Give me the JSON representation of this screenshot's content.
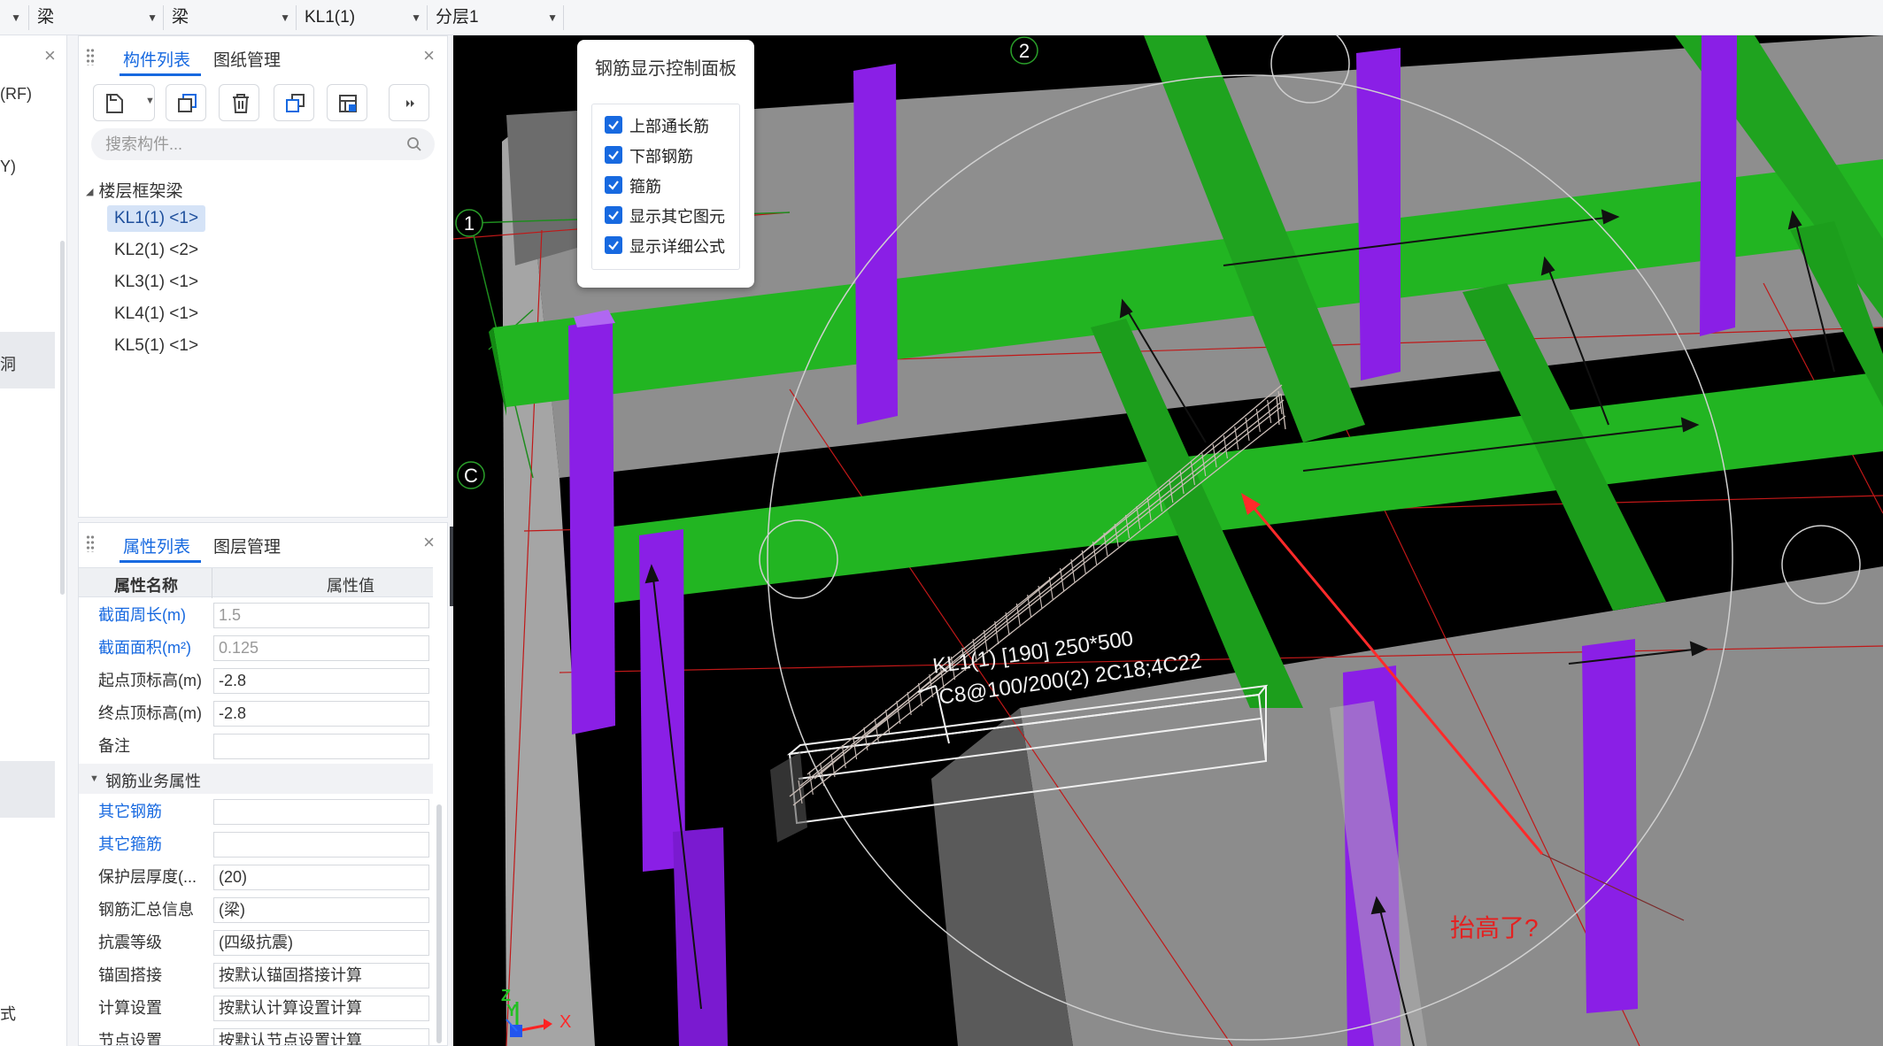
{
  "topbar": {
    "dropdowns": [
      {
        "value": ""
      },
      {
        "value": "梁"
      },
      {
        "value": "梁"
      },
      {
        "value": "KL1(1)"
      },
      {
        "value": "分层1"
      }
    ]
  },
  "farleft": {
    "items": [
      "(RF)",
      "Y)",
      "洞",
      "式"
    ]
  },
  "component_panel": {
    "tabs": [
      "构件列表",
      "图纸管理"
    ],
    "active_tab": 0,
    "search_placeholder": "搜索构件...",
    "tree_group": "楼层框架梁",
    "items": [
      "KL1(1) <1>",
      "KL2(1) <2>",
      "KL3(1) <1>",
      "KL4(1) <1>",
      "KL5(1) <1>"
    ],
    "selected_index": 0
  },
  "property_panel": {
    "tabs": [
      "属性列表",
      "图层管理"
    ],
    "active_tab": 0,
    "header_name": "属性名称",
    "header_value": "属性值",
    "rows": [
      {
        "name": "截面周长(m)",
        "value": "1.5",
        "blue": true,
        "gray": true
      },
      {
        "name": "截面面积(m²)",
        "value": "0.125",
        "blue": true,
        "gray": true
      },
      {
        "name": "起点顶标高(m)",
        "value": "-2.8",
        "blue": false,
        "gray": false
      },
      {
        "name": "终点顶标高(m)",
        "value": "-2.8",
        "blue": false,
        "gray": false
      },
      {
        "name": "备注",
        "value": "",
        "blue": false,
        "gray": false
      }
    ],
    "section": "钢筋业务属性",
    "rows2": [
      {
        "name": "其它钢筋",
        "value": "",
        "blue": true
      },
      {
        "name": "其它箍筋",
        "value": "",
        "blue": true
      },
      {
        "name": "保护层厚度(...",
        "value": "(20)",
        "blue": false
      },
      {
        "name": "钢筋汇总信息",
        "value": "(梁)",
        "blue": false
      },
      {
        "name": "抗震等级",
        "value": "(四级抗震)",
        "blue": false
      },
      {
        "name": "锚固搭接",
        "value": "按默认锚固搭接计算",
        "blue": false
      },
      {
        "name": "计算设置",
        "value": "按默认计算设置计算",
        "blue": false
      },
      {
        "name": "节点设置",
        "value": "按默认节点设置计算",
        "blue": false
      }
    ]
  },
  "rebar_panel": {
    "title": "钢筋显示控制面板",
    "options": [
      {
        "label": "上部通长筋",
        "checked": true
      },
      {
        "label": "下部钢筋",
        "checked": true
      },
      {
        "label": "箍筋",
        "checked": true
      },
      {
        "label": "显示其它图元",
        "checked": true
      },
      {
        "label": "显示详细公式",
        "checked": true
      }
    ]
  },
  "viewport": {
    "axis_labels": [
      "2",
      "1",
      "C"
    ],
    "beam_label_line1": "KL1(1) [190] 250*500",
    "beam_label_line2": "C8@100/200(2) 2C18;4C22",
    "annotation": "抬高了?",
    "gizmo_x": "X",
    "gizmo_y": "Y",
    "gizmo_z": "Z",
    "colors": {
      "beam_green": "#22b522",
      "column_purple": "#8a1fe6",
      "slab_gray": "#8c8c8c",
      "annotation_red": "#ff2a2a"
    }
  }
}
